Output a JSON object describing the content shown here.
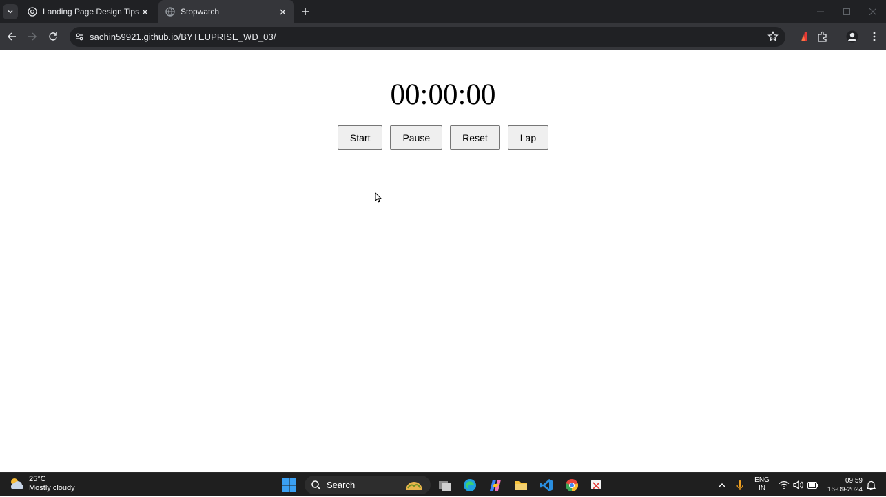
{
  "browser": {
    "tabs": [
      {
        "title": "Landing Page Design Tips",
        "active": false
      },
      {
        "title": "Stopwatch",
        "active": true
      }
    ],
    "url": "sachin59921.github.io/BYTEUPRISE_WD_03/"
  },
  "stopwatch": {
    "time": "00:00:00",
    "buttons": {
      "start": "Start",
      "pause": "Pause",
      "reset": "Reset",
      "lap": "Lap"
    }
  },
  "taskbar": {
    "weather": {
      "temp": "25°C",
      "condition": "Mostly cloudy"
    },
    "search_label": "Search",
    "lang": {
      "line1": "ENG",
      "line2": "IN"
    },
    "clock": {
      "time": "09:59",
      "date": "16-09-2024"
    }
  },
  "colors": {
    "tabbar": "#202124",
    "toolbar": "#35363a",
    "button_bg": "#efefef",
    "taskbar": "#1f1f1f"
  }
}
